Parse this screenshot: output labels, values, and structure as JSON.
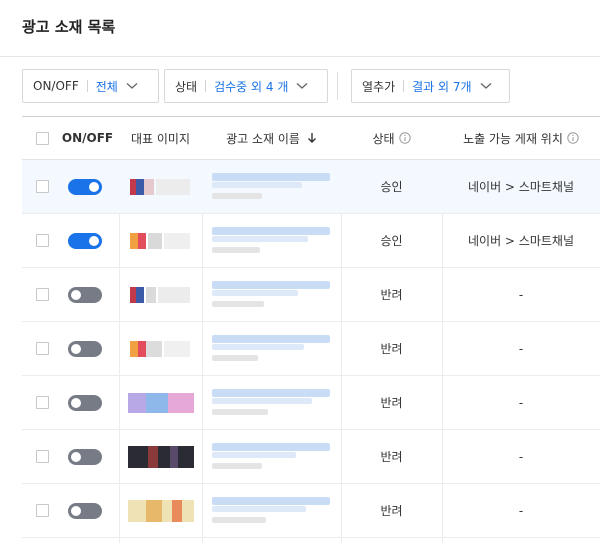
{
  "page_title": "광고 소재 목록",
  "filters": [
    {
      "label": "ON/OFF",
      "value": "전체"
    },
    {
      "label": "상태",
      "value": "검수중 외 4 개"
    },
    {
      "label": "열추가",
      "value": "결과 외 7개"
    }
  ],
  "columns": {
    "onoff": "ON/OFF",
    "image": "대표 이미지",
    "name": "광고 소재 이름",
    "status": "상태",
    "placement": "노출 가능 게재 위치"
  },
  "rows": [
    {
      "on": true,
      "status": "승인",
      "placement": "네이버 > 스마트채널"
    },
    {
      "on": true,
      "status": "승인",
      "placement": "네이버 > 스마트채널"
    },
    {
      "on": false,
      "status": "반려",
      "placement": "-"
    },
    {
      "on": false,
      "status": "반려",
      "placement": "-"
    },
    {
      "on": false,
      "status": "반려",
      "placement": "-"
    },
    {
      "on": false,
      "status": "반려",
      "placement": "-"
    },
    {
      "on": false,
      "status": "반려",
      "placement": "-"
    }
  ],
  "colors": {
    "accent": "#1a73e8",
    "toggle_off": "#777b85"
  },
  "icons": {
    "sort": "arrow-down-icon",
    "info": "info-circle-icon",
    "dropdown": "chevron-down-icon"
  }
}
